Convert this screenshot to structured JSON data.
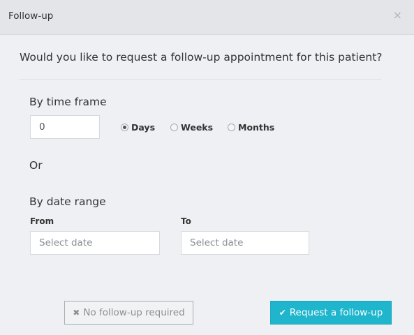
{
  "dialog": {
    "title": "Follow-up",
    "close_glyph": "×",
    "question": "Would you like to request a follow-up appointment for this patient?"
  },
  "time_frame": {
    "title": "By time frame",
    "value": "0",
    "units": [
      {
        "label": "Days",
        "checked": true
      },
      {
        "label": "Weeks",
        "checked": false
      },
      {
        "label": "Months",
        "checked": false
      }
    ]
  },
  "or_label": "Or",
  "date_range": {
    "title": "By date range",
    "from_label": "From",
    "from_placeholder": "Select date",
    "to_label": "To",
    "to_placeholder": "Select date"
  },
  "actions": {
    "no_followup_icon": "✖",
    "no_followup_label": "No follow-up required",
    "request_icon": "✔",
    "request_label": "Request a follow-up"
  },
  "colors": {
    "accent": "#1fb5cc",
    "header_bg": "#e3e5e8",
    "body_bg": "#eef0f3"
  },
  "icons": {
    "close": "close-icon",
    "no_followup": "times-icon",
    "request": "check-icon"
  }
}
